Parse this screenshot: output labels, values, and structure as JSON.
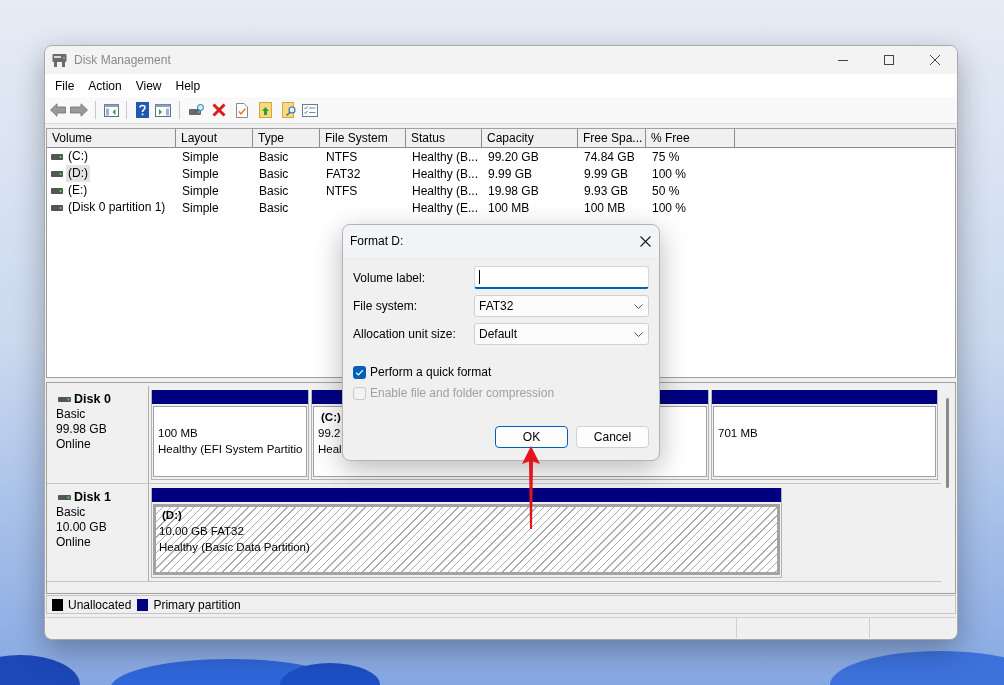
{
  "window": {
    "title": "Disk Management"
  },
  "menu": [
    "File",
    "Action",
    "View",
    "Help"
  ],
  "volume_table": {
    "columns": [
      "Volume",
      "Layout",
      "Type",
      "File System",
      "Status",
      "Capacity",
      "Free Spa...",
      "% Free"
    ],
    "rows": [
      {
        "volume": "(C:)",
        "layout": "Simple",
        "type": "Basic",
        "file_system": "NTFS",
        "status": "Healthy (B...",
        "capacity": "99.20 GB",
        "free_space": "74.84 GB",
        "percent_free": "75 %",
        "selected": false
      },
      {
        "volume": "(D:)",
        "layout": "Simple",
        "type": "Basic",
        "file_system": "FAT32",
        "status": "Healthy (B...",
        "capacity": "9.99 GB",
        "free_space": "9.99 GB",
        "percent_free": "100 %",
        "selected": true
      },
      {
        "volume": "(E:)",
        "layout": "Simple",
        "type": "Basic",
        "file_system": "NTFS",
        "status": "Healthy (B...",
        "capacity": "19.98 GB",
        "free_space": "9.93 GB",
        "percent_free": "50 %",
        "selected": false
      },
      {
        "volume": "(Disk 0 partition 1)",
        "layout": "Simple",
        "type": "Basic",
        "status": "Healthy (E...",
        "capacity": "100 MB",
        "free_space": "100 MB",
        "percent_free": "100 %",
        "selected": false
      }
    ]
  },
  "disks": [
    {
      "name": "Disk 0",
      "type": "Basic",
      "size": "99.98 GB",
      "status": "Online",
      "partitions": [
        {
          "lines": [
            "100 MB",
            "Healthy (EFI System Partitio"
          ],
          "selected": false
        },
        {
          "label": "(C:)",
          "lines": [
            "99.2",
            "Heal"
          ],
          "selected": false
        },
        {
          "lines": [
            "701 MB"
          ],
          "selected": false
        }
      ]
    },
    {
      "name": "Disk 1",
      "type": "Basic",
      "size": "10.00 GB",
      "status": "Online",
      "partitions": [
        {
          "label": "(D:)",
          "lines": [
            "10.00 GB FAT32",
            "Healthy (Basic Data Partition)"
          ],
          "selected": true
        }
      ]
    }
  ],
  "legend": [
    {
      "label": "Unallocated",
      "color": "#000000"
    },
    {
      "label": "Primary partition",
      "color": "#000080"
    }
  ],
  "dialog": {
    "title": "Format D:",
    "fields": [
      {
        "kind": "text",
        "label": "Volume label:",
        "focused": true
      },
      {
        "kind": "select",
        "label": "File system:",
        "value": "FAT32"
      },
      {
        "kind": "select",
        "label": "Allocation unit size:",
        "value": "Default"
      }
    ],
    "checkboxes": [
      {
        "label": "Perform a quick format",
        "checked": true,
        "disabled": false
      },
      {
        "label": "Enable file and folder compression",
        "checked": false,
        "disabled": true
      }
    ],
    "buttons": [
      {
        "label": "OK",
        "default": true
      },
      {
        "label": "Cancel",
        "default": false
      }
    ]
  }
}
